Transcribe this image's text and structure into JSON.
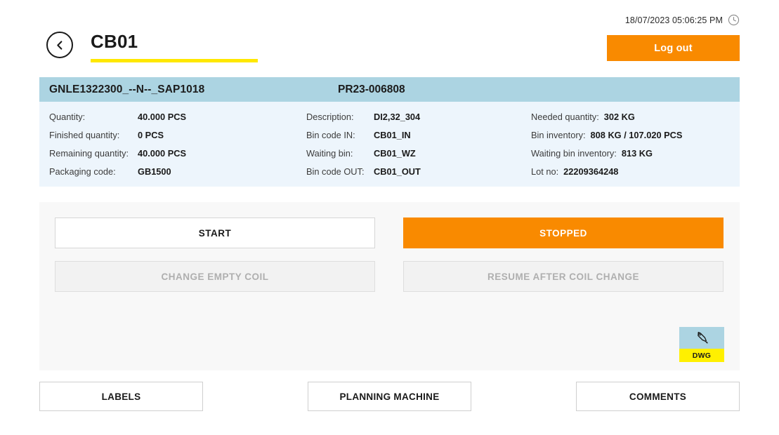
{
  "topbar": {
    "timestamp": "18/07/2023 05:06:25 PM",
    "clock_icon": "clock-icon",
    "back_icon": "chevron-left-circle-icon",
    "title": "CB01",
    "logout_label": "Log out",
    "accent_orange": "#F98A00",
    "accent_yellow": "#FFE800"
  },
  "info": {
    "header": {
      "material_code": "GNLE1322300_--N--_SAP1018",
      "order_no": "PR23-006808",
      "band_color": "#ACD4E2",
      "panel_color": "#EDF5FC"
    },
    "columns": [
      {
        "rows": [
          {
            "label": "Quantity:",
            "value": "40.000 PCS"
          },
          {
            "label": "Finished quantity:",
            "value": "0 PCS"
          },
          {
            "label": "Remaining quantity:",
            "value": "40.000 PCS"
          },
          {
            "label": "Packaging code:",
            "value": "GB1500"
          }
        ]
      },
      {
        "rows": [
          {
            "label": "Description:",
            "value": "DI2,32_304"
          },
          {
            "label": "Bin code IN:",
            "value": "CB01_IN"
          },
          {
            "label": "Waiting bin:",
            "value": "CB01_WZ"
          },
          {
            "label": "Bin code OUT:",
            "value": "CB01_OUT"
          }
        ]
      },
      {
        "rows": [
          {
            "label": "Needed quantity:",
            "value": "302 KG"
          },
          {
            "label": "Bin inventory:",
            "value": "808 KG / 107.020 PCS"
          },
          {
            "label": "Waiting bin inventory:",
            "value": "813 KG"
          },
          {
            "label": "Lot no:",
            "value": "22209364248"
          }
        ]
      }
    ]
  },
  "actions": {
    "start_label": "START",
    "stopped_label": "STOPPED",
    "change_coil_label": "CHANGE EMPTY COIL",
    "resume_coil_label": "RESUME AFTER COIL CHANGE"
  },
  "dwg": {
    "label": "DWG",
    "icon": "pen-nib-icon",
    "top_color": "#ACD4E2",
    "bottom_color": "#FFF000"
  },
  "bottom_nav": {
    "labels": [
      "LABELS",
      "PLANNING MACHINE",
      "COMMENTS"
    ]
  }
}
